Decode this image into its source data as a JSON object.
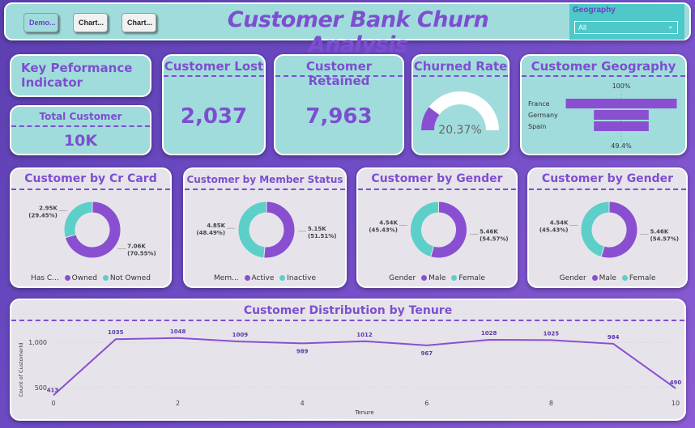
{
  "header": {
    "title": "Customer Bank Churn Analysis",
    "buttons": [
      "Demo...",
      "Chart...",
      "Chart..."
    ],
    "slicer": {
      "label": "Geography",
      "value": "All"
    }
  },
  "kpi": {
    "indicator_title": "Key Peformance Indicator",
    "total_customer": {
      "label": "Total Customer",
      "value": "10K"
    },
    "customer_lost": {
      "label": "Customer Lost",
      "value": "2,037"
    },
    "customer_retained": {
      "label": "Customer Retained",
      "value": "7,963"
    },
    "churned_rate": {
      "label": "Churned Rate",
      "value": "20.37%"
    }
  },
  "colors": {
    "purple": "#7d4fd0",
    "teal": "#5ccfc9",
    "card": "#a0dcdc",
    "light": "#e6e4ea"
  },
  "chart_data": [
    {
      "type": "gauge",
      "title": "Churned Rate",
      "value": 20.37,
      "max": 100,
      "label": "20.37%"
    },
    {
      "type": "bar",
      "title": "Customer Geography",
      "categories": [
        "France",
        "Germany",
        "Spain"
      ],
      "values": [
        100,
        49.4,
        49.4
      ],
      "top_label": "100%",
      "bottom_label": "49.4%"
    },
    {
      "type": "pie",
      "title": "Customer by Cr Card",
      "legend_title": "Has C...",
      "slices": [
        {
          "name": "Owned",
          "value": 7.06,
          "label": "7.06K (70.55%)",
          "color": "#8a4fd0"
        },
        {
          "name": "Not Owned",
          "value": 2.95,
          "label": "2.95K (29.45%)",
          "color": "#5ccfc9"
        }
      ]
    },
    {
      "type": "pie",
      "title": "Customer by Member Status",
      "legend_title": "Mem...",
      "slices": [
        {
          "name": "Active",
          "value": 5.15,
          "label": "5.15K (51.51%)",
          "color": "#8a4fd0"
        },
        {
          "name": "Inactive",
          "value": 4.85,
          "label": "4.85K (48.49%)",
          "color": "#5ccfc9"
        }
      ]
    },
    {
      "type": "pie",
      "title": "Customer by Gender",
      "legend_title": "Gender",
      "slices": [
        {
          "name": "Male",
          "value": 5.46,
          "label": "5.46K (54.57%)",
          "color": "#8a4fd0"
        },
        {
          "name": "Female",
          "value": 4.54,
          "label": "4.54K (45.43%)",
          "color": "#5ccfc9"
        }
      ]
    },
    {
      "type": "pie",
      "title": "Customer by Gender",
      "legend_title": "Gender",
      "slices": [
        {
          "name": "Male",
          "value": 5.46,
          "label": "5.46K (54.57%)",
          "color": "#8a4fd0"
        },
        {
          "name": "Female",
          "value": 4.54,
          "label": "4.54K (45.43%)",
          "color": "#5ccfc9"
        }
      ]
    },
    {
      "type": "line",
      "title": "Customer Distribution by Tenure",
      "xlabel": "Tenure",
      "ylabel": "Count of CustomerId",
      "x": [
        0,
        1,
        2,
        3,
        4,
        5,
        6,
        7,
        8,
        9,
        10
      ],
      "y": [
        413,
        1035,
        1048,
        1009,
        989,
        1012,
        967,
        1028,
        1025,
        984,
        490
      ],
      "xticks": [
        0,
        2,
        4,
        6,
        8,
        10
      ],
      "yticks": [
        500,
        1000
      ],
      "ytick_labels": [
        "500",
        "1,000"
      ],
      "ylim": [
        400,
        1100
      ],
      "xlim": [
        0,
        10
      ],
      "color": "#8a4fd0"
    }
  ]
}
